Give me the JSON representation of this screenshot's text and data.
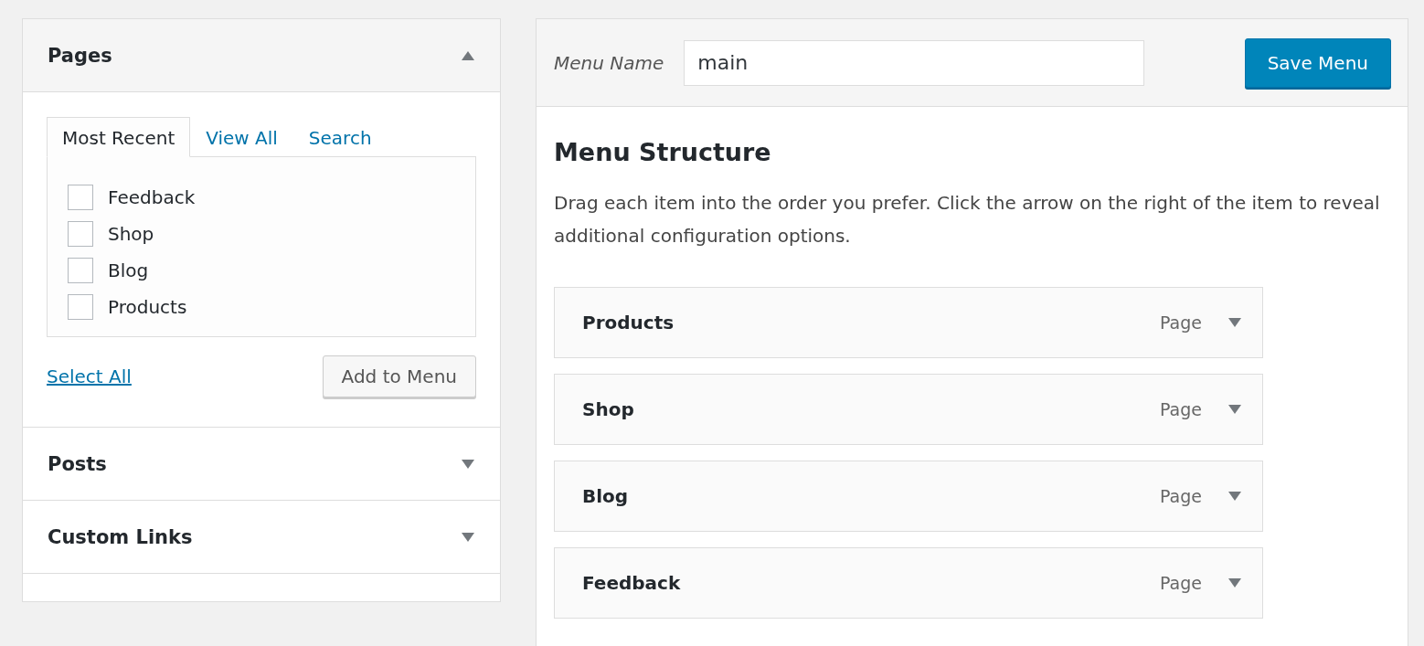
{
  "pages_panel": {
    "title": "Pages",
    "expanded": true,
    "tabs": [
      {
        "label": "Most Recent",
        "selected": true
      },
      {
        "label": "View All",
        "selected": false
      },
      {
        "label": "Search",
        "selected": false
      }
    ],
    "items": [
      {
        "label": "Feedback",
        "checked": false
      },
      {
        "label": "Shop",
        "checked": false
      },
      {
        "label": "Blog",
        "checked": false
      },
      {
        "label": "Products",
        "checked": false
      }
    ],
    "select_all": "Select All",
    "add_button": "Add to Menu"
  },
  "sections": [
    {
      "title": "Posts",
      "expanded": false
    },
    {
      "title": "Custom Links",
      "expanded": false
    }
  ],
  "menu_editor": {
    "name_label": "Menu Name",
    "name_value": "main",
    "save_button": "Save Menu",
    "heading": "Menu Structure",
    "description": "Drag each item into the order you prefer. Click the arrow on the right of the item to reveal additional configuration options.",
    "items": [
      {
        "title": "Products",
        "type": "Page"
      },
      {
        "title": "Shop",
        "type": "Page"
      },
      {
        "title": "Blog",
        "type": "Page"
      },
      {
        "title": "Feedback",
        "type": "Page"
      }
    ]
  }
}
